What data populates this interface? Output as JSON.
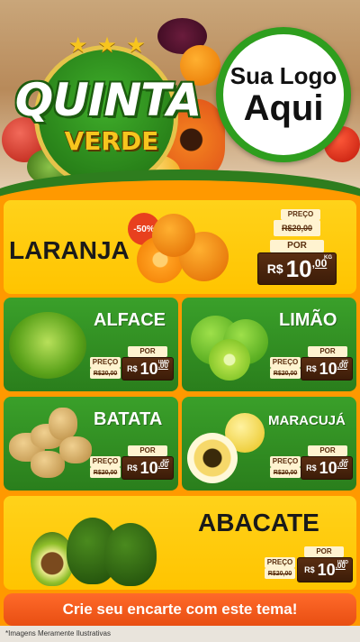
{
  "header": {
    "title_line1": "QUINTA",
    "title_line2": "VERDE",
    "stars": "★ ★ ★",
    "logo_line1": "Sua Logo",
    "logo_line2": "Aqui"
  },
  "products": [
    {
      "id": "laranja",
      "name": "LARANJA",
      "discount": "-50%",
      "label_preco": "PREÇO",
      "old_price": "R$20,00",
      "label_por": "POR",
      "currency": "R$",
      "price_int": "10",
      "price_cents": ",00",
      "unit": "KG"
    },
    {
      "id": "alface",
      "name": "ALFACE",
      "label_preco": "PREÇO",
      "old_price": "R$20,00",
      "label_por": "POR",
      "currency": "R$",
      "price_int": "10",
      "price_cents": ",00",
      "unit": "UNID"
    },
    {
      "id": "limao",
      "name": "LIMÃO",
      "label_preco": "PREÇO",
      "old_price": "R$20,00",
      "label_por": "POR",
      "currency": "R$",
      "price_int": "10",
      "price_cents": ",00",
      "unit": "KG"
    },
    {
      "id": "batata",
      "name": "BATATA",
      "label_preco": "PREÇO",
      "old_price": "R$20,00",
      "label_por": "POR",
      "currency": "R$",
      "price_int": "10",
      "price_cents": ",00",
      "unit": "KG"
    },
    {
      "id": "maracuja",
      "name": "MARACUJÁ",
      "label_preco": "PREÇO",
      "old_price": "R$20,00",
      "label_por": "POR",
      "currency": "R$",
      "price_int": "10",
      "price_cents": ",00",
      "unit": "KG"
    },
    {
      "id": "abacate",
      "name": "ABACATE",
      "label_preco": "PREÇO",
      "old_price": "R$20,00",
      "label_por": "POR",
      "currency": "R$",
      "price_int": "10",
      "price_cents": ",00",
      "unit": "UNID"
    }
  ],
  "cta": "Crie seu encarte com este tema!",
  "footnote": "*Imagens Meramente Ilustrativas",
  "colors": {
    "green": "#2e7d1e",
    "orange": "#ff9900",
    "yellow": "#ffc400",
    "brown": "#3c1c08",
    "cta": "#e84e12"
  }
}
